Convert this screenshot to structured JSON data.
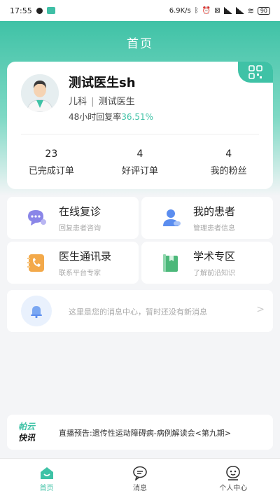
{
  "status_bar": {
    "time": "17:55",
    "net_speed": "6.9K/s",
    "battery": "90"
  },
  "header": {
    "title": "首页"
  },
  "profile": {
    "name": "测试医生sh",
    "dept": "儿科",
    "separator": "|",
    "title": "测试医生",
    "reply_label": "48小时回复率",
    "reply_rate": "36.51%"
  },
  "stats": [
    {
      "value": "23",
      "label": "已完成订单"
    },
    {
      "value": "4",
      "label": "好评订单"
    },
    {
      "value": "4",
      "label": "我的粉丝"
    }
  ],
  "tiles": [
    {
      "title": "在线复诊",
      "subtitle": "回复患者咨询"
    },
    {
      "title": "我的患者",
      "subtitle": "管理患者信息"
    },
    {
      "title": "医生通讯录",
      "subtitle": "联系平台专家"
    },
    {
      "title": "学术专区",
      "subtitle": "了解前沿知识"
    }
  ],
  "notice": {
    "text": "这里是您的消息中心，暂时还没有新消息",
    "arrow": ">"
  },
  "news": {
    "logo_top": "帕云",
    "logo_bottom": "快讯",
    "text": "直播预告:遗传性运动障碍病-病例解读会<第九期>"
  },
  "tabs": [
    {
      "label": "首页"
    },
    {
      "label": "消息"
    },
    {
      "label": "个人中心"
    }
  ],
  "colors": {
    "accent": "#3fc2a6",
    "background": "#f4f5f7"
  }
}
